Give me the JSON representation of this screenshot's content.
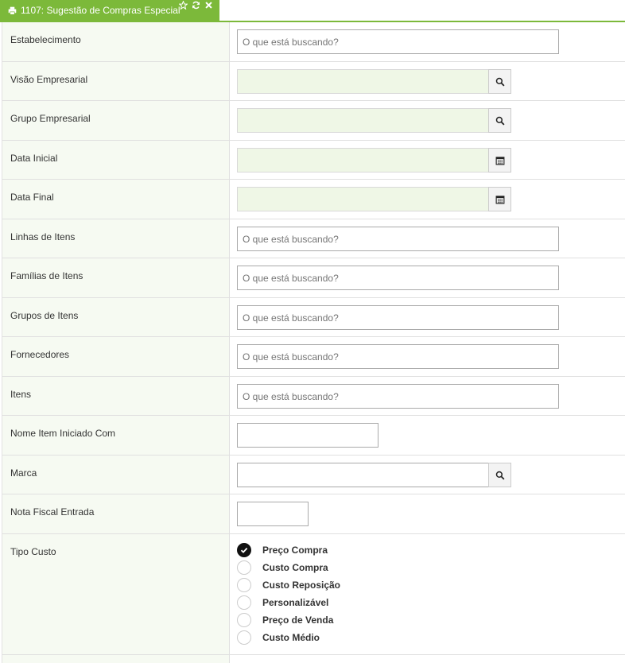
{
  "tab": {
    "title": "1107: Sugestão de Compras Especial",
    "icons": [
      "print-icon",
      "star-icon",
      "refresh-icon",
      "close-icon"
    ]
  },
  "fields": {
    "estabelecimento": {
      "label": "Estabelecimento",
      "placeholder": "O que está buscando?"
    },
    "visao": {
      "label": "Visão Empresarial",
      "value": "",
      "button_icon": "search-icon"
    },
    "grupo_emp": {
      "label": "Grupo Empresarial",
      "value": "",
      "button_icon": "search-icon"
    },
    "data_inicial": {
      "label": "Data Inicial",
      "value": "",
      "button_icon": "calendar-icon"
    },
    "data_final": {
      "label": "Data Final",
      "value": "",
      "button_icon": "calendar-icon"
    },
    "linhas": {
      "label": "Linhas de Itens",
      "placeholder": "O que está buscando?"
    },
    "familias": {
      "label": "Famílias de Itens",
      "placeholder": "O que está buscando?"
    },
    "grupos": {
      "label": "Grupos de Itens",
      "placeholder": "O que está buscando?"
    },
    "fornecedores": {
      "label": "Fornecedores",
      "placeholder": "O que está buscando?"
    },
    "itens": {
      "label": "Itens",
      "placeholder": "O que está buscando?"
    },
    "nome_item": {
      "label": "Nome Item Iniciado Com",
      "value": ""
    },
    "marca": {
      "label": "Marca",
      "value": "",
      "button_icon": "search-icon"
    },
    "nota_fiscal": {
      "label": "Nota Fiscal Entrada",
      "value": ""
    },
    "tipo_custo": {
      "label": "Tipo Custo",
      "selected": "Preço Compra",
      "options": [
        "Preço Compra",
        "Custo Compra",
        "Custo Reposição",
        "Personalizável",
        "Preço de Venda",
        "Custo Médio"
      ]
    }
  },
  "colors": {
    "accent": "#7cb93a",
    "label_bg": "#f6faf2",
    "readonly_input_bg": "#eff7e6"
  }
}
